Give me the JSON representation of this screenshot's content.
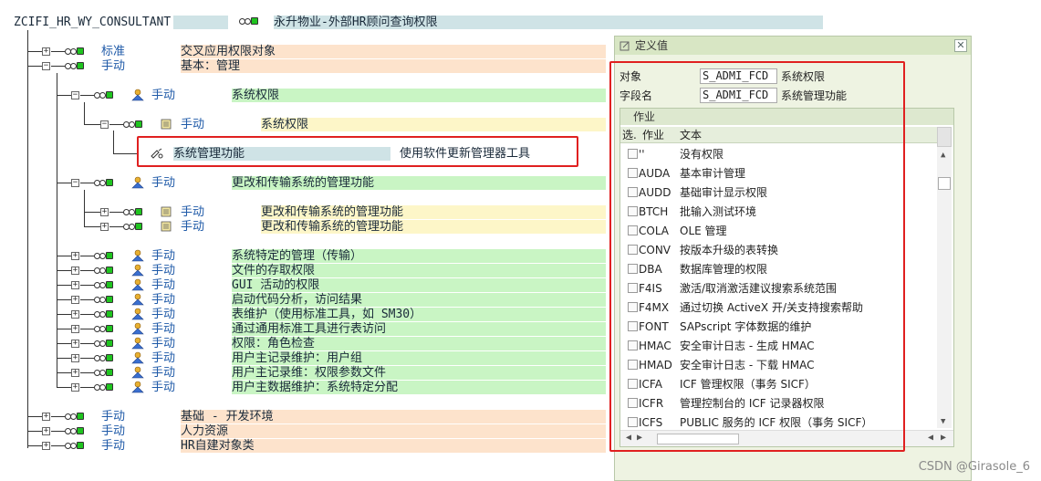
{
  "header": {
    "user": "ZCIFI_HR_WY_CONSULTANT",
    "role_title": "永升物业-外部HR顾问查询权限"
  },
  "tree": [
    {
      "status": "标准",
      "text": "交叉应用权限对象"
    },
    {
      "status": "手动",
      "text": "基本：管理"
    },
    {
      "status": "手动",
      "text": "系统权限"
    },
    {
      "status": "手动",
      "text": "系统权限"
    },
    {
      "status": "系统管理功能",
      "text": "使用软件更新管理器工具"
    },
    {
      "status": "手动",
      "text": "更改和传输系统的管理功能"
    },
    {
      "status": "手动",
      "text": "更改和传输系统的管理功能"
    },
    {
      "status": "手动",
      "text": "更改和传输系统的管理功能"
    },
    {
      "status": "手动",
      "text": "系统特定的管理（传输）"
    },
    {
      "status": "手动",
      "text": "文件的存取权限"
    },
    {
      "status": "手动",
      "text": "GUI 活动的权限"
    },
    {
      "status": "手动",
      "text": "启动代码分析，访问结果"
    },
    {
      "status": "手动",
      "text": "表维护（使用标准工具，如 SM30）"
    },
    {
      "status": "手动",
      "text": "通过通用标准工具进行表访问"
    },
    {
      "status": "手动",
      "text": "权限：角色检查"
    },
    {
      "status": "手动",
      "text": "用户主记录维护：用户组"
    },
    {
      "status": "手动",
      "text": "用户主记录维：权限参数文件"
    },
    {
      "status": "手动",
      "text": "用户主数据维护：系统特定分配"
    },
    {
      "status": "手动",
      "text": "基础 -  开发环境"
    },
    {
      "status": "手动",
      "text": "人力资源"
    },
    {
      "status": "手动",
      "text": "HR自建对象类"
    }
  ],
  "dialog": {
    "title": "定义值",
    "close": "✕",
    "object_label": "对象",
    "object_value": "S_ADMI_FCD",
    "object_desc": "系统权限",
    "field_label": "字段名",
    "field_value": "S_ADMI_FCD",
    "field_desc": "系统管理功能",
    "table_title": "作业",
    "columns": [
      "选.",
      "作业",
      "文本"
    ],
    "rows": [
      {
        "code": "''",
        "text": "没有权限"
      },
      {
        "code": "AUDA",
        "text": "基本审计管理"
      },
      {
        "code": "AUDD",
        "text": "基础审计显示权限"
      },
      {
        "code": "BTCH",
        "text": "批输入测试环境"
      },
      {
        "code": "COLA",
        "text": "OLE 管理"
      },
      {
        "code": "CONV",
        "text": "按版本升级的表转换"
      },
      {
        "code": "DBA",
        "text": "数据库管理的权限"
      },
      {
        "code": "F4IS",
        "text": "激活/取消激活建议搜索系统范围"
      },
      {
        "code": "F4MX",
        "text": "通过切换 ActiveX 开/关支持搜索帮助"
      },
      {
        "code": "FONT",
        "text": "SAPscript 字体数据的维护"
      },
      {
        "code": "HMAC",
        "text": "安全审计日志 - 生成 HMAC"
      },
      {
        "code": "HMAD",
        "text": "安全审计日志 - 下载 HMAC"
      },
      {
        "code": "ICFA",
        "text": "ICF 管理权限（事务 SICF）"
      },
      {
        "code": "ICFR",
        "text": "管理控制台的 ICF 记录器权限"
      },
      {
        "code": "ICFS",
        "text": "PUBLIC 服务的 ICF 权限（事务 SICF）"
      }
    ]
  },
  "watermark": "CSDN @Girasole_6",
  "colors": {
    "orange": "#fde3cc",
    "green": "#c9f5c4",
    "yellow": "#fdf6c8",
    "teal": "#cfe3e6",
    "red": "#e02020"
  }
}
